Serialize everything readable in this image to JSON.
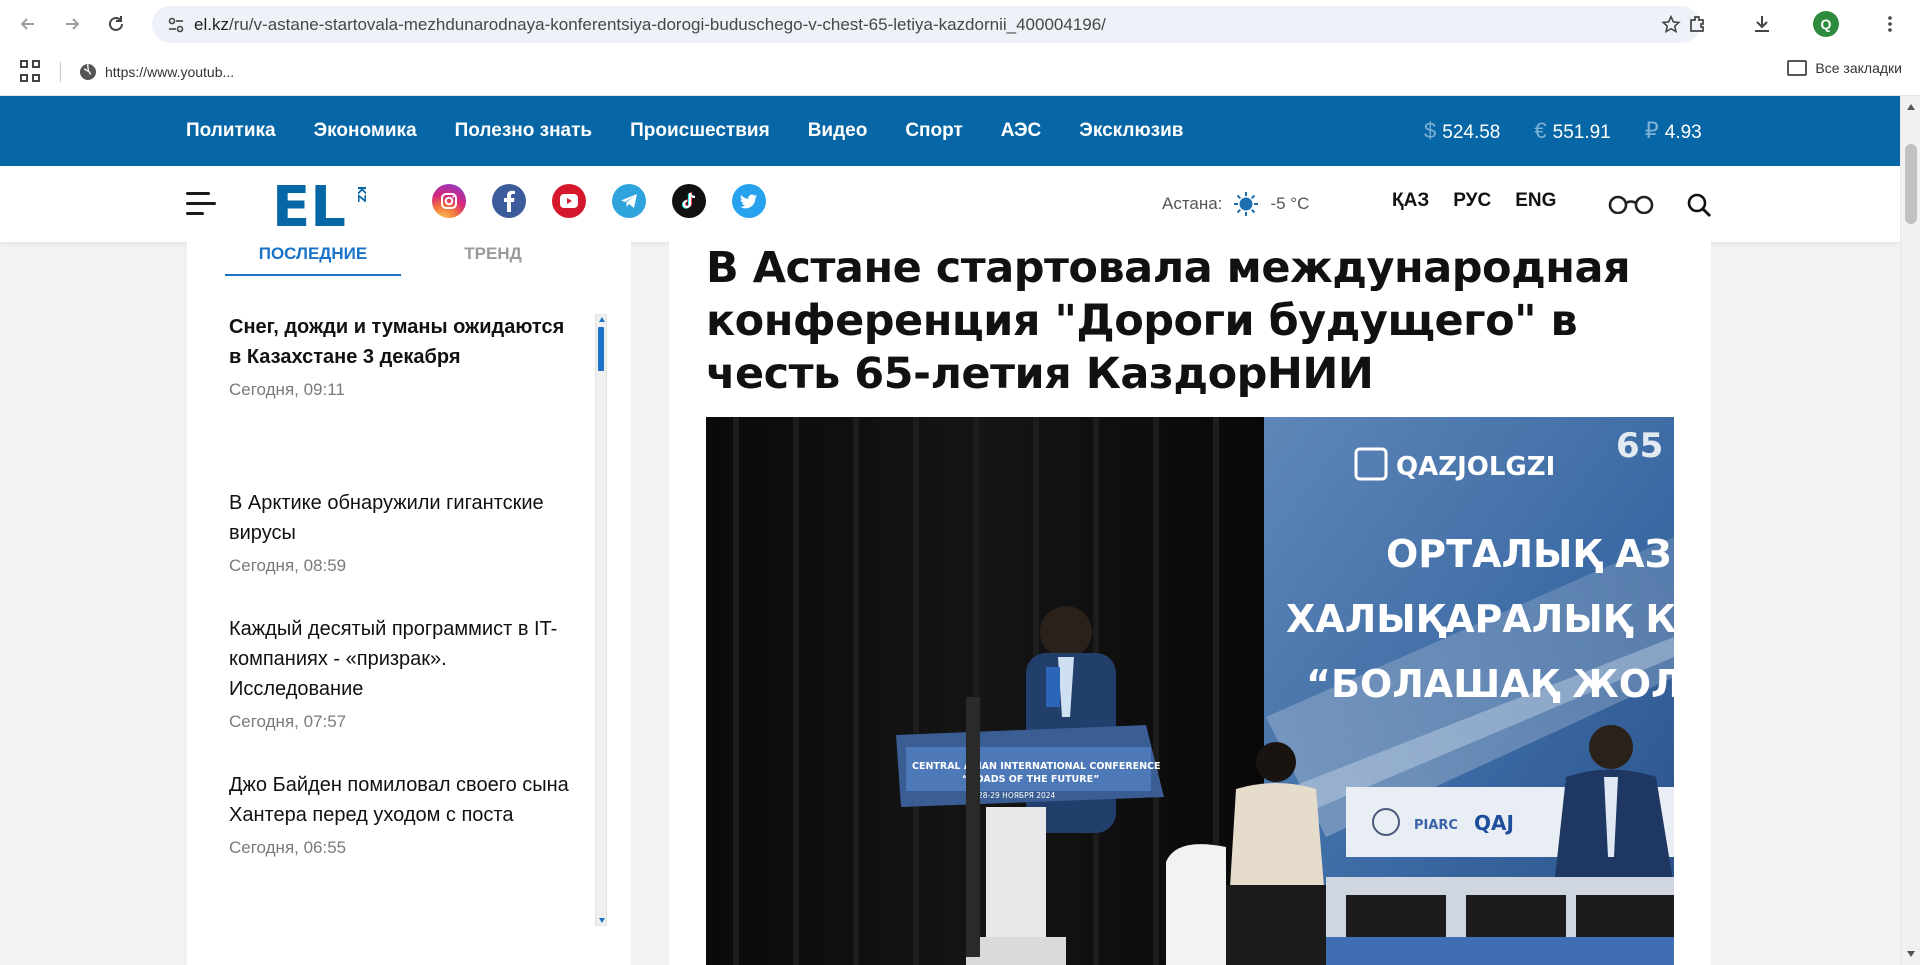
{
  "browser": {
    "url_domain": "el.kz",
    "url_path": "/ru/v-astane-startovala-mezhdunarodnaya-konferentsiya-dorogi-buduschego-v-chest-65-letiya-kazdornii_400004196/",
    "profile_initial": "Q",
    "bookmark_item": "https://www.youtub...",
    "all_bookmarks": "Все закладки"
  },
  "nav": {
    "links": [
      "Политика",
      "Экономика",
      "Полезно знать",
      "Происшествия",
      "Видео",
      "Спорт",
      "АЭС",
      "Эксклюзив"
    ]
  },
  "rates": [
    {
      "symbol": "$",
      "value": "524.58"
    },
    {
      "symbol": "€",
      "value": "551.91"
    },
    {
      "symbol": "₽",
      "value": "4.93"
    }
  ],
  "header": {
    "logo_text": "EL",
    "logo_sub": "KZ",
    "weather_city": "Астана:",
    "weather_temp": "-5 °C",
    "langs": [
      "ҚАЗ",
      "РУС",
      "ENG"
    ]
  },
  "sidebar": {
    "tabs": [
      "ПОСЛЕДНИЕ",
      "ТРЕНД"
    ],
    "news": [
      {
        "title": "Снег, дожди и туманы ожидаются в Казахстане 3 декабря",
        "time": "Сегодня, 09:11"
      },
      {
        "title": "В Арктике обнаружили гигантские вирусы",
        "time": "Сегодня, 08:59"
      },
      {
        "title": "Каждый десятый программист в IT-компаниях - «призрак». Исследование",
        "time": "Сегодня, 07:57"
      },
      {
        "title": "Джо Байден помиловал своего сына Хантера перед уходом с поста",
        "time": "Сегодня, 06:55"
      }
    ]
  },
  "article": {
    "headline": "В Астане стартовала международная конференция \"Дороги будущего\" в честь 65-летия КаздорНИИ",
    "photo_text": {
      "brand": "QAZJOLGZI",
      "banner_line1": "ОРТАЛЫҚ АЗИЯ",
      "banner_line2": "ХАЛЫҚАРАЛЫҚ КОНФЕ",
      "banner_line3": "“БОЛАШАҚ ЖОЛДА",
      "podium_line1": "CENTRAL ASIAN INTERNATIONAL CONFERENCE",
      "podium_line2": "“ROADS OF THE FUTURE”",
      "podium_date": "28-29 НОЯБРЯ 2024",
      "anniv": "65",
      "logos": [
        "PIARC",
        "QAJ"
      ]
    }
  },
  "colors": {
    "nav_bg": "#0767a6",
    "accent_blue": "#1a73c8"
  }
}
